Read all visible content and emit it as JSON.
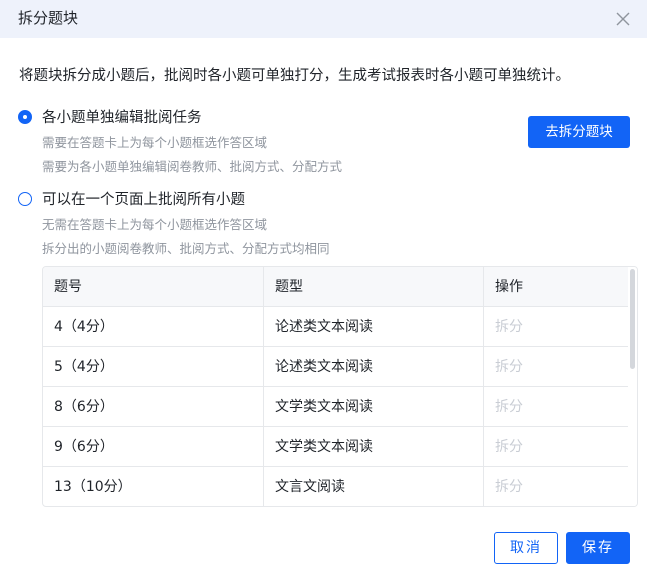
{
  "dialog": {
    "title": "拆分题块",
    "close_icon": "close-icon"
  },
  "intro_text": "将题块拆分成小题后，批阅时各小题可单独打分，生成考试报表时各小题可单独统计。",
  "options": [
    {
      "label": "各小题单独编辑批阅任务",
      "checked": true,
      "desc1": "需要在答题卡上为每个小题框选作答区域",
      "desc2": "需要为各小题单独编辑阅卷教师、批阅方式、分配方式"
    },
    {
      "label": "可以在一个页面上批阅所有小题",
      "checked": false,
      "desc1": "无需在答题卡上为每个小题框选作答区域",
      "desc2": "拆分出的小题阅卷教师、批阅方式、分配方式均相同"
    }
  ],
  "split_button_label": "去拆分题块",
  "table": {
    "headers": [
      "题号",
      "题型",
      "操作"
    ],
    "rows": [
      {
        "number": "4（4分）",
        "type": "论述类文本阅读",
        "action": "拆分"
      },
      {
        "number": "5（4分）",
        "type": "论述类文本阅读",
        "action": "拆分"
      },
      {
        "number": "8（6分）",
        "type": "文学类文本阅读",
        "action": "拆分"
      },
      {
        "number": "9（6分）",
        "type": "文学类文本阅读",
        "action": "拆分"
      },
      {
        "number": "13（10分）",
        "type": "文言文阅读",
        "action": "拆分"
      }
    ]
  },
  "footer": {
    "cancel_label": "取消",
    "save_label": "保存"
  },
  "colors": {
    "primary": "#1264f6",
    "header_bg": "#eef2fb",
    "muted_text": "#8f959e",
    "disabled_text": "#c9cdd4"
  }
}
